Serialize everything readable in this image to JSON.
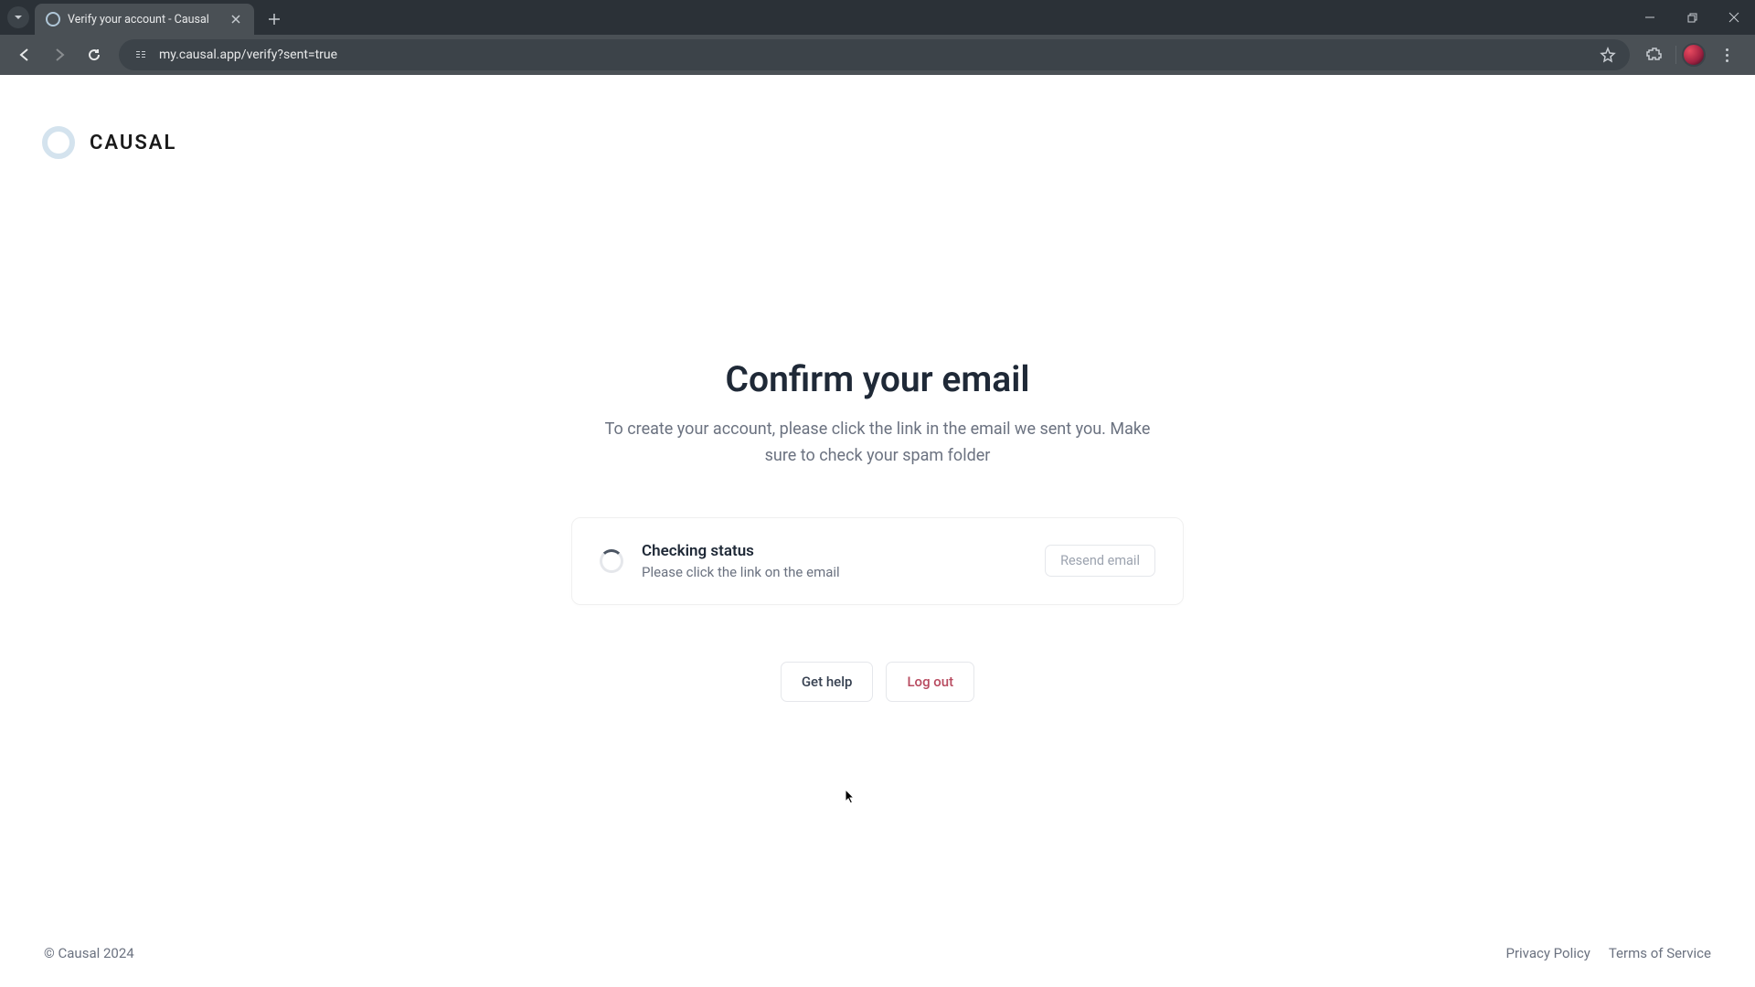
{
  "browser": {
    "tab_title": "Verify your account - Causal",
    "url": "my.causal.app/verify?sent=true"
  },
  "logo": {
    "text": "CAUSAL"
  },
  "main": {
    "title": "Confirm your email",
    "subtitle": "To create your account, please click the link in the email we sent you. Make sure to check your spam folder"
  },
  "status_card": {
    "title": "Checking status",
    "description": "Please click the link on the email",
    "resend_label": "Resend email"
  },
  "actions": {
    "help_label": "Get help",
    "logout_label": "Log out"
  },
  "footer": {
    "copyright": "© Causal 2024",
    "privacy_label": "Privacy Policy",
    "terms_label": "Terms of Service"
  }
}
